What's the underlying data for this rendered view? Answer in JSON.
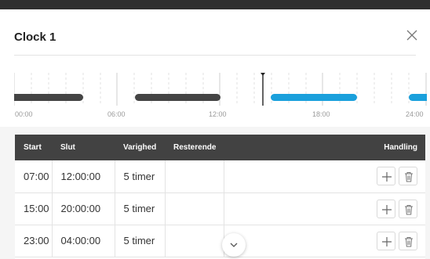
{
  "dialog": {
    "title": "Clock 1"
  },
  "timeline": {
    "labels": [
      "00:00",
      "06:00",
      "12:00",
      "18:00",
      "24:00"
    ],
    "accent_color": "#1aa0dc",
    "inactive_color": "#444444"
  },
  "table": {
    "columns": [
      "Start",
      "Slut",
      "Varighed",
      "Resterende",
      "Handling"
    ],
    "rows": [
      {
        "start": "07:00",
        "slut": "12:00:00",
        "varighed": "5 timer",
        "resterende": ""
      },
      {
        "start": "15:00",
        "slut": "20:00:00",
        "varighed": "5 timer",
        "resterende": ""
      },
      {
        "start": "23:00",
        "slut": "04:00:00",
        "varighed": "5 timer",
        "resterende": ""
      }
    ],
    "row_actions": [
      "plus-icon",
      "trash-icon"
    ]
  },
  "icons": {
    "close": "close-icon",
    "expand": "chevron-down-icon"
  }
}
